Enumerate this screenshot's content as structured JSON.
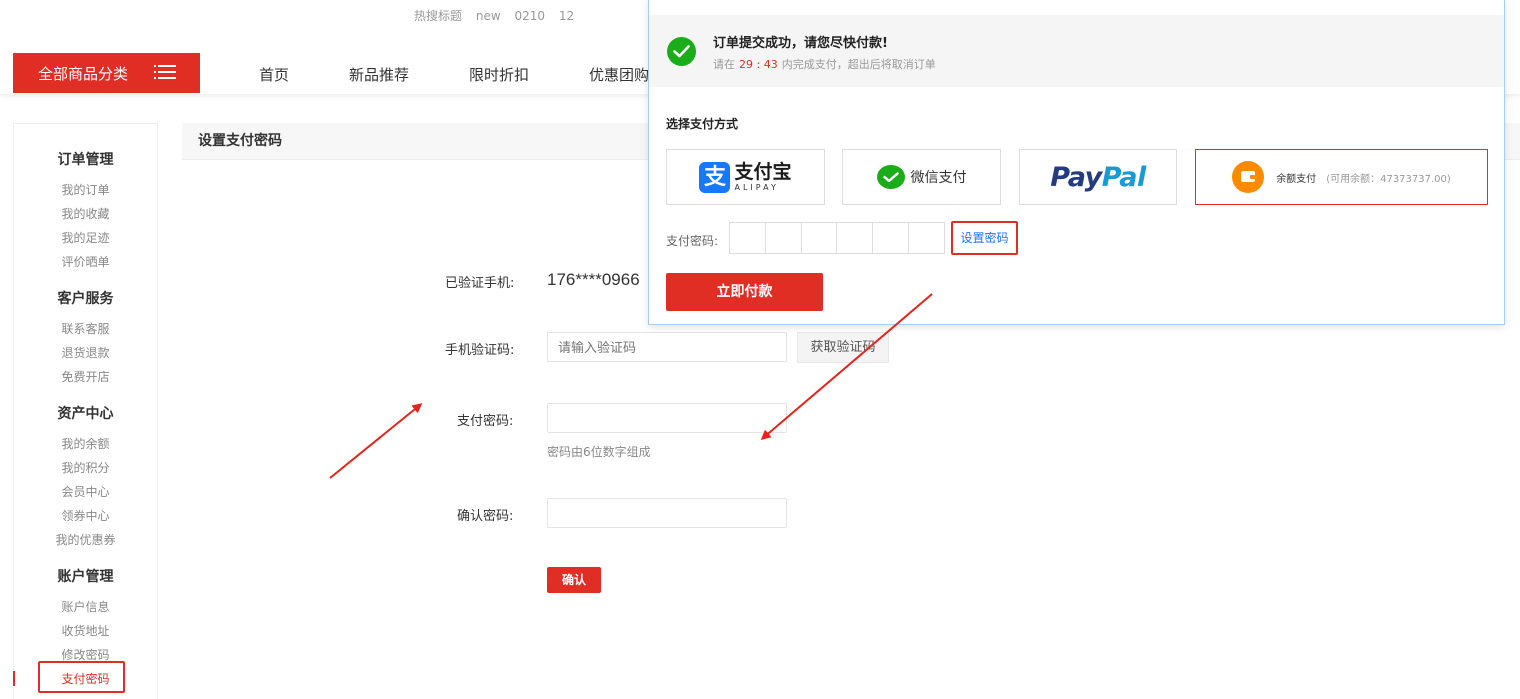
{
  "hot_search": [
    "热搜标题",
    "new",
    "0210",
    "12"
  ],
  "nav": {
    "all_categories": "全部商品分类",
    "links": [
      "首页",
      "新品推荐",
      "限时折扣",
      "优惠团购"
    ]
  },
  "sidebar": {
    "groups": [
      {
        "title": "订单管理",
        "items": [
          "我的订单",
          "我的收藏",
          "我的足迹",
          "评价晒单"
        ]
      },
      {
        "title": "客户服务",
        "items": [
          "联系客服",
          "退货退款",
          "免费开店"
        ]
      },
      {
        "title": "资产中心",
        "items": [
          "我的余额",
          "我的积分",
          "会员中心",
          "领券中心",
          "我的优惠券"
        ]
      },
      {
        "title": "账户管理",
        "items": [
          "账户信息",
          "收货地址",
          "修改密码",
          "支付密码"
        ]
      }
    ],
    "active_item": "支付密码"
  },
  "main": {
    "title": "设置支付密码",
    "phone_label": "已验证手机:",
    "phone_value": "176****0966",
    "code_label": "手机验证码:",
    "code_placeholder": "请输入验证码",
    "get_code": "获取验证码",
    "password_label": "支付密码:",
    "password_hint": "密码由6位数字组成",
    "confirm_label": "确认密码:",
    "confirm_button": "确认"
  },
  "popup": {
    "success_title": "订单提交成功，请您尽快付款!",
    "success_prefix": "请在",
    "countdown": "29 : 43",
    "success_suffix": "内完成支付，超出后将取消订单",
    "choose_payment": "选择支付方式",
    "alipay_cn": "支付宝",
    "alipay_en": "ALIPAY",
    "wechat": "微信支付",
    "paypal_1": "Pay",
    "paypal_2": "Pal",
    "balance": "余额支付",
    "balance_available": "(可用余额：47373737.00)",
    "password_label": "支付密码:",
    "set_password": "设置密码",
    "pay_now": "立即付款"
  },
  "colors": {
    "accent": "#e02e24",
    "link": "#1677ff",
    "success": "#1aad19",
    "annotation": "#e8231a"
  }
}
